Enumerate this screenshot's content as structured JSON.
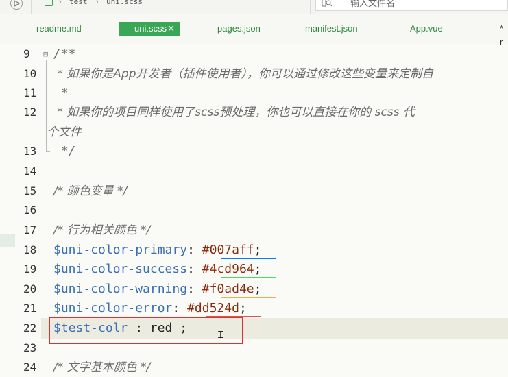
{
  "topbar": {
    "breadcrumb": [
      "test",
      "uni.scss"
    ],
    "search_placeholder": "输入文件名"
  },
  "tabs": [
    {
      "label": "readme.md",
      "active": false
    },
    {
      "label": "uni.scss",
      "active": true
    },
    {
      "label": "pages.json",
      "active": false
    },
    {
      "label": "manifest.json",
      "active": false
    },
    {
      "label": "App.vue",
      "active": false
    },
    {
      "label": "* r",
      "active": false
    }
  ],
  "editor": {
    "line_numbers": [
      "9",
      "10",
      "11",
      "12",
      "13",
      "14",
      "15",
      "16",
      "17",
      "18",
      "19",
      "20",
      "21",
      "22",
      "23",
      "24"
    ],
    "lines": {
      "l9": "/**",
      "l10": " * 如果你是App开发者（插件使用者），你可以通过修改这些变量来定制自",
      "l11": " *",
      "l12": " * 如果你的项目同样使用了scss预处理，你也可以直接在你的 scss 代",
      "l12b": "个文件",
      "l13": " */",
      "l15": "/* 颜色变量 */",
      "l17": "/* 行为相关颜色 */",
      "l18_var": "$uni-color-primary",
      "l18_val": "#007aff",
      "l19_var": "$uni-color-success",
      "l19_val": "#4cd964",
      "l20_var": "$uni-color-warning",
      "l20_val": "#f0ad4e",
      "l21_var": "$uni-color-error",
      "l21_val": "#dd524d",
      "l22_var": "$test-colr",
      "l22_rest": " : red ;",
      "l24": "/* 文字基本颜色 */"
    },
    "colon": ":",
    "semicolon": ";"
  },
  "colors": {
    "accent_tab": "#3aa757",
    "highlight_box": "#e0302f",
    "primary": "#007aff",
    "success": "#4cd964",
    "warning": "#f0ad4e",
    "error": "#dd524d"
  }
}
